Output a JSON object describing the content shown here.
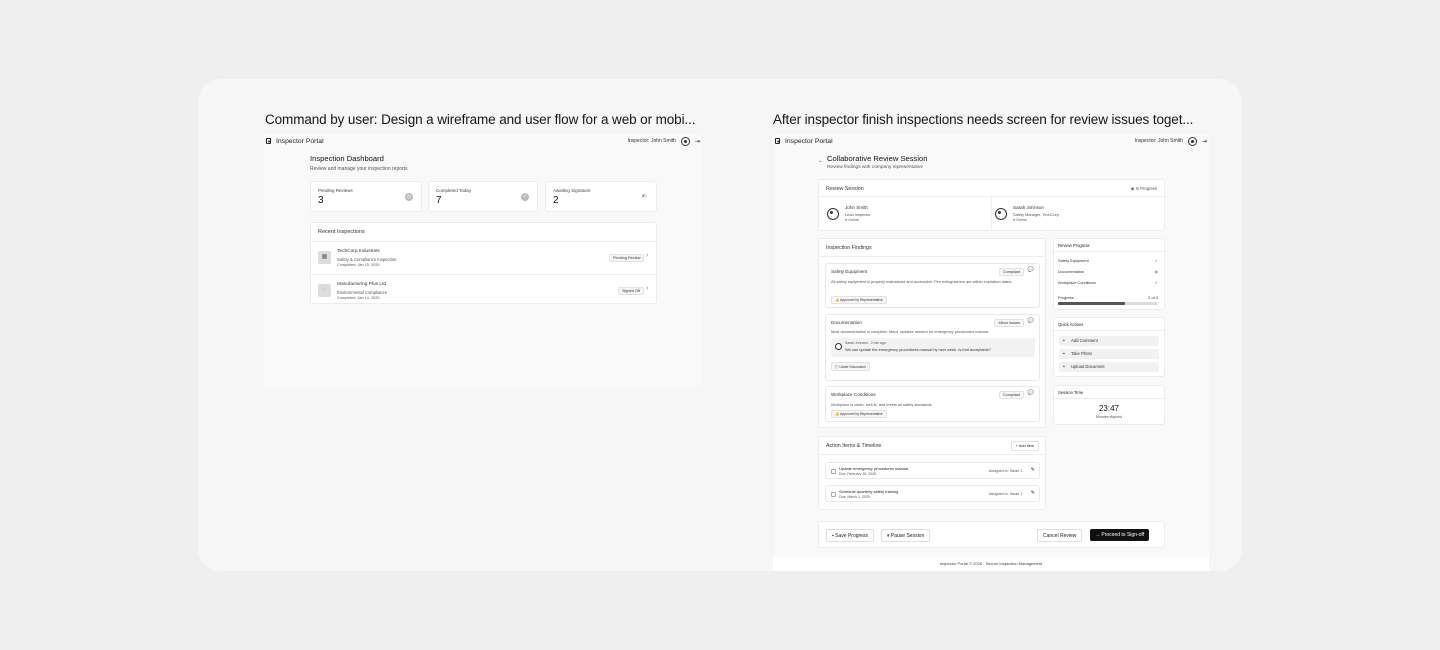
{
  "titles": {
    "left": "Command by user: Design a wireframe and user flow for a web or mobi...",
    "right": "After inspector finish inspections needs screen for review issues toget..."
  },
  "header": {
    "brand": "Inspector Portal",
    "inspector": "Inspector: John Smith"
  },
  "dashboard": {
    "title": "Inspection Dashboard",
    "subtitle": "Review and manage your inspection reports",
    "stats": [
      {
        "label": "Pending Reviews",
        "value": "3",
        "icon": "clock-icon"
      },
      {
        "label": "Completed Today",
        "value": "7",
        "icon": "check-circle-icon"
      },
      {
        "label": "Awaiting Signature",
        "value": "2",
        "icon": "signature-icon"
      }
    ],
    "recent_title": "Recent Inspections",
    "inspections": [
      {
        "company": "TechCorp Industries",
        "type": "Safety & Compliance Inspection",
        "date": "Completed: Jan 15, 2025",
        "status": "Pending Review",
        "icon": "building-icon"
      },
      {
        "company": "Manufacturing Plus Ltd",
        "type": "Environmental Compliance",
        "date": "Completed: Jan 14, 2025",
        "status": "Signed Off",
        "icon": "leaf-icon"
      }
    ]
  },
  "review": {
    "title": "Collaborative Review Session",
    "subtitle": "Review findings with company representative",
    "session_title": "Review Session",
    "session_status": "In Progress",
    "participants": [
      {
        "name": "John Smith",
        "role": "Lead Inspector",
        "status": "Online"
      },
      {
        "name": "Sarah Johnson",
        "role": "Safety Manager, TechCorp",
        "status": "Online"
      }
    ],
    "findings_title": "Inspection Findings",
    "findings": [
      {
        "title": "Safety Equipment",
        "badge": "Compliant",
        "text": "All safety equipment is properly maintained and accessible. Fire extinguishers are within expiration dates.",
        "tag": "Approved by Representative"
      },
      {
        "title": "Documentation",
        "badge": "Minor Issues",
        "text": "Most documentation is complete. Minor updates needed for emergency procedures manual.",
        "comment_author": "Sarah Johnson · 2 min ago",
        "comment_text": "We can update the emergency procedures manual by next week. Is that acceptable?",
        "tag": "Under Discussion"
      },
      {
        "title": "Workplace Conditions",
        "badge": "Compliant",
        "text": "Workplace is clean, well-lit, and meets all safety standards.",
        "tag": "Approved by Representative"
      }
    ],
    "progress": {
      "title": "Review Progress",
      "items": [
        "Safety Equipment",
        "Documentation",
        "Workplace Conditions"
      ],
      "label": "Progress",
      "value": "2 of 3",
      "fraction": 0.667
    },
    "quick_actions": {
      "title": "Quick Actions",
      "items": [
        "Add Comment",
        "Take Photo",
        "Upload Document"
      ]
    },
    "session_time": {
      "title": "Session Time",
      "value": "23:47",
      "label": "Minutes elapsed"
    },
    "actions": {
      "title": "Action Items & Timeline",
      "add_label": "Add Item",
      "items": [
        {
          "title": "Update emergency procedures manual",
          "due": "Due: February 15, 2025",
          "assigned": "Assigned to: Sarah J."
        },
        {
          "title": "Schedule quarterly safety training",
          "due": "Due: March 1, 2025",
          "assigned": "Assigned to: Sarah J."
        }
      ]
    },
    "footer_buttons": {
      "save": "Save Progress",
      "pause": "Pause Session",
      "cancel": "Cancel Review",
      "proceed": "Proceed to Sign-off"
    },
    "footer": "Inspector Portal © 2025 - Secure Inspection Management"
  }
}
